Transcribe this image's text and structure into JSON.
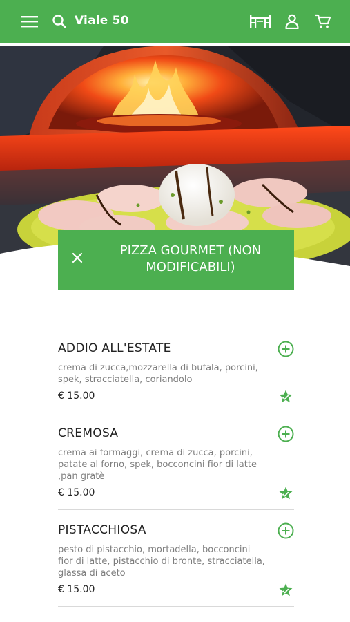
{
  "header": {
    "location": "Viale 50",
    "icons": [
      "menu-icon",
      "search-icon",
      "table-icon",
      "user-icon",
      "cart-icon"
    ]
  },
  "category": {
    "title": "PIZZA GOURMET (NON MODIFICABILI)",
    "close_icon": "close-icon"
  },
  "items": [
    {
      "name": "ADDIO ALL'ESTATE",
      "description": "crema di zucca,mozzarella di bufala, porcini, spek, stracciatella, coriandolo",
      "price": "€ 15.00"
    },
    {
      "name": "CREMOSA",
      "description": "crema ai formaggi, crema di zucca, porcini, patate al forno, spek, bocconcini fior di latte ,pan gratè",
      "price": "€ 15.00"
    },
    {
      "name": "PISTACCHIOSA",
      "description": "pesto di pistacchio, mortadella, bocconcini fior di latte, pistacchio di bronte, stracciatella, glassa di aceto",
      "price": "€ 15.00"
    }
  ],
  "colors": {
    "brand_green": "#4caf50",
    "text_dark": "#222222",
    "text_muted": "#7d7d7d"
  }
}
